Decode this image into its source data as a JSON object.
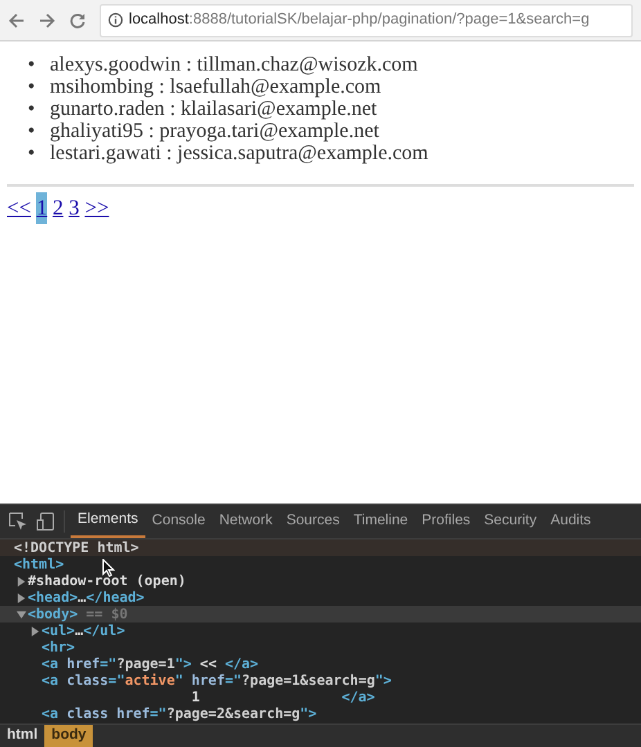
{
  "browser": {
    "url_host": "localhost",
    "url_rest": ":8888/tutorialSK/belajar-php/pagination/?page=1&search=g"
  },
  "users": [
    {
      "bullet": "•",
      "text": "alexys.goodwin : tillman.chaz@wisozk.com"
    },
    {
      "bullet": "•",
      "text": "msihombing : lsaefullah@example.com"
    },
    {
      "bullet": "•",
      "text": "gunarto.raden : klailasari@example.net"
    },
    {
      "bullet": "•",
      "text": "ghaliyati95 : prayoga.tari@example.net"
    },
    {
      "bullet": "•",
      "text": "lestari.gawati : jessica.saputra@example.com"
    }
  ],
  "pagination": [
    {
      "label": "<<",
      "selected": false
    },
    {
      "label": "1",
      "selected": true
    },
    {
      "label": "2",
      "selected": false
    },
    {
      "label": "3",
      "selected": false
    },
    {
      "label": ">>",
      "selected": false
    }
  ],
  "devtools": {
    "tabs": [
      {
        "label": "Elements",
        "selected": true
      },
      {
        "label": "Console",
        "selected": false
      },
      {
        "label": "Network",
        "selected": false
      },
      {
        "label": "Sources",
        "selected": false
      },
      {
        "label": "Timeline",
        "selected": false
      },
      {
        "label": "Profiles",
        "selected": false
      },
      {
        "label": "Security",
        "selected": false
      },
      {
        "label": "Audits",
        "selected": false
      }
    ],
    "tree": [
      {
        "selected": false,
        "hovered": true,
        "segments": [
          {
            "kind": "doctype",
            "text": "<!DOCTYPE html>"
          }
        ]
      },
      {
        "selected": false,
        "hovered": false,
        "segments": [
          {
            "kind": "tag",
            "text": "<html>"
          }
        ],
        "children": [
          {
            "selected": false,
            "hovered": false,
            "expanded": false,
            "segments": [
              {
                "kind": "text",
                "text": "#shadow-root (open)"
              }
            ]
          },
          {
            "selected": false,
            "hovered": false,
            "expanded": false,
            "segments": [
              {
                "kind": "tag",
                "text": "<head>"
              },
              {
                "kind": "text",
                "text": "…"
              },
              {
                "kind": "tag",
                "text": "</head>"
              }
            ]
          },
          {
            "selected": true,
            "hovered": false,
            "expanded": true,
            "segments": [
              {
                "kind": "tag",
                "text": "<body>"
              },
              {
                "kind": "note",
                "text": " == $0"
              }
            ],
            "children": [
              {
                "selected": false,
                "hovered": false,
                "expanded": false,
                "segments": [
                  {
                    "kind": "tag",
                    "text": "<ul>"
                  },
                  {
                    "kind": "text",
                    "text": "…"
                  },
                  {
                    "kind": "tag",
                    "text": "</ul>"
                  }
                ]
              },
              {
                "selected": false,
                "hovered": false,
                "segments": [
                  {
                    "kind": "tag",
                    "text": "<hr>"
                  }
                ]
              },
              {
                "selected": false,
                "hovered": false,
                "segments": [
                  {
                    "kind": "tag",
                    "text": "<a "
                  },
                  {
                    "kind": "attr",
                    "text": "href"
                  },
                  {
                    "kind": "tag",
                    "text": "=\""
                  },
                  {
                    "kind": "link",
                    "text": "?page=1"
                  },
                  {
                    "kind": "tag",
                    "text": "\">"
                  },
                  {
                    "kind": "text",
                    "text": " << "
                  },
                  {
                    "kind": "tag",
                    "text": "</a>"
                  }
                ]
              },
              {
                "selected": false,
                "hovered": false,
                "segments": [
                  {
                    "kind": "tag",
                    "text": "<a "
                  },
                  {
                    "kind": "attr",
                    "text": "class"
                  },
                  {
                    "kind": "tag",
                    "text": "=\""
                  },
                  {
                    "kind": "value",
                    "text": "active"
                  },
                  {
                    "kind": "tag",
                    "text": "\" "
                  },
                  {
                    "kind": "attr",
                    "text": "href"
                  },
                  {
                    "kind": "tag",
                    "text": "=\""
                  },
                  {
                    "kind": "link",
                    "text": "?page=1&search=g"
                  },
                  {
                    "kind": "tag",
                    "text": "\">"
                  }
                ],
                "continuation": [
                  {
                    "kind": "text",
                    "text": "                  1                 "
                  },
                  {
                    "kind": "tag",
                    "text": "</a>"
                  }
                ]
              },
              {
                "selected": false,
                "hovered": false,
                "segments": [
                  {
                    "kind": "tag",
                    "text": "<a "
                  },
                  {
                    "kind": "attr",
                    "text": "class href"
                  },
                  {
                    "kind": "tag",
                    "text": "=\""
                  },
                  {
                    "kind": "link",
                    "text": "?page=2&search=g"
                  },
                  {
                    "kind": "tag",
                    "text": "\">"
                  }
                ]
              }
            ]
          }
        ]
      }
    ],
    "breadcrumbs": [
      {
        "label": "html",
        "selected": false
      },
      {
        "label": "body",
        "selected": true
      }
    ]
  }
}
